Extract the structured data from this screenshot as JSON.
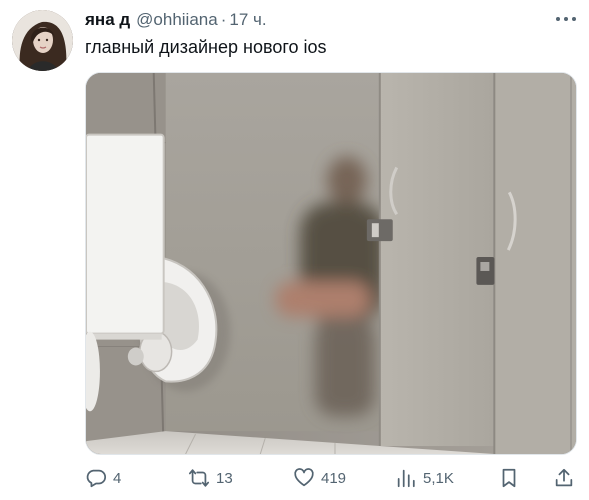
{
  "tweet": {
    "display_name": "яна д",
    "handle": "@ohhiiana",
    "separator": "·",
    "time": "17 ч.",
    "text": "главный дизайнер нового ios"
  },
  "media": {
    "description_icon": "photo"
  },
  "actions": {
    "reply_count": "4",
    "retweet_count": "13",
    "like_count": "419",
    "views_count": "5,1K"
  },
  "icons": {
    "more": "more-horizontal-icon",
    "reply": "reply-icon",
    "retweet": "retweet-icon",
    "like": "heart-icon",
    "views": "views-icon",
    "bookmark": "bookmark-icon",
    "share": "share-icon"
  },
  "colors": {
    "primary_text": "#0f1419",
    "secondary_text": "#536471"
  }
}
